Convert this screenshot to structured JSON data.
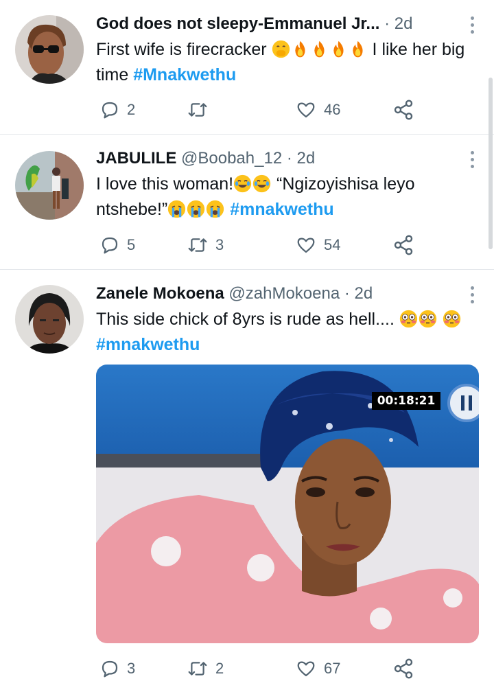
{
  "tweets": [
    {
      "name": "God does not sleepy-Emmanuel Jr...",
      "handle": "",
      "dot": "·",
      "time": "2d",
      "text_before": "First wife is firecracker",
      "emoji_before": [
        "hand-over-mouth-emoji",
        "fire-emoji",
        "fire-emoji",
        "fire-emoji",
        "fire-emoji"
      ],
      "text_middle": "I like her big time",
      "hashtag": "#Mnakwethu",
      "replies": "2",
      "retweets": "",
      "likes": "46"
    },
    {
      "name": "JABULILE",
      "handle": "@Boobah_12",
      "dot": "·",
      "time": "2d",
      "text_before": "I love this woman!",
      "emoji_a": [
        "joy-emoji",
        "joy-emoji"
      ],
      "text_middle": "“Ngizoyishisa leyo ntshebe!”",
      "emoji_b": [
        "crying-emoji",
        "crying-emoji",
        "crying-emoji"
      ],
      "hashtag": "#mnakwethu",
      "replies": "5",
      "retweets": "3",
      "likes": "54"
    },
    {
      "name": "Zanele Mokoena",
      "handle": "@zahMokoena",
      "dot": "·",
      "time": "2d",
      "text_before": "This side chick of 8yrs is rude as hell....",
      "emoji_a": [
        "flushed-emoji",
        "flushed-emoji",
        "flushed-emoji"
      ],
      "hashtag": "#mnakwethu",
      "media_timer": "00:18:21",
      "replies": "3",
      "retweets": "2",
      "likes": "67"
    }
  ],
  "colors": {
    "text": "#0f1419",
    "secondary": "#536471",
    "hashtag": "#1d9bf0",
    "divider": "#e3e6ea"
  }
}
